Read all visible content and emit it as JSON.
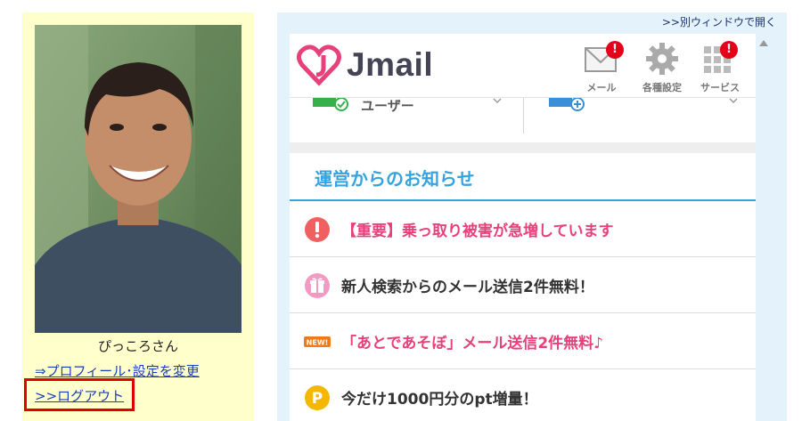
{
  "profile": {
    "name": "ぴっころさん",
    "profile_link": "⇒プロフィール･設定を変更",
    "logout_link": ">>ログアウト"
  },
  "panel": {
    "new_window_link": ">>別ウィンドウで開く"
  },
  "header": {
    "logo_text": "Jmail",
    "buttons": [
      {
        "label": "メール",
        "icon": "mail-icon",
        "badge": "!"
      },
      {
        "label": "各種設定",
        "icon": "gear-icon",
        "badge": ""
      },
      {
        "label": "サービス",
        "icon": "grid-icon",
        "badge": "!"
      }
    ]
  },
  "tabs": [
    {
      "label": "ユーザー",
      "icon": "user-check-icon"
    },
    {
      "label": "",
      "icon": "user-add-icon"
    }
  ],
  "news": {
    "title": "運営からのお知らせ",
    "items": [
      {
        "text": "【重要】乗っ取り被害が急増しています",
        "icon": "alert-icon",
        "color": "#e8407a"
      },
      {
        "text": "新人検索からのメール送信2件無料！",
        "icon": "gift-icon",
        "color": "#333333"
      },
      {
        "text": "「あとであそぼ」メール送信2件無料♪",
        "icon": "new-icon",
        "icon_text": "NEW!",
        "color": "#e8407a"
      },
      {
        "text": "今だけ1000円分のpt増量！",
        "icon": "point-icon",
        "icon_text": "P",
        "color": "#333333"
      }
    ]
  },
  "colors": {
    "accent": "#35a3e0",
    "pink": "#e8407a",
    "badge_red": "#e5001a",
    "logout_highlight": "#e00000"
  }
}
